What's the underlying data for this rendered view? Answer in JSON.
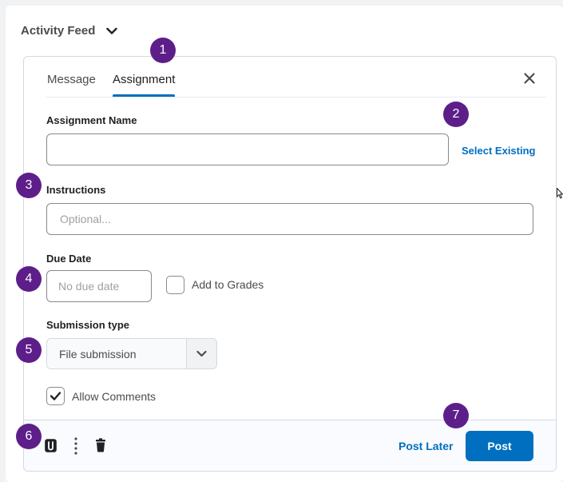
{
  "feed": {
    "title": "Activity Feed",
    "toggle_icon": "chevron-down-icon"
  },
  "tabs": [
    {
      "label": "Message",
      "active": false
    },
    {
      "label": "Assignment",
      "active": true
    }
  ],
  "close_icon": "close-icon",
  "form": {
    "assignment_name": {
      "label": "Assignment Name",
      "value": "",
      "placeholder": ""
    },
    "select_existing": "Select Existing",
    "instructions": {
      "label": "Instructions",
      "placeholder": "Optional..."
    },
    "due_date": {
      "label": "Due Date",
      "placeholder": "No due date"
    },
    "add_to_grades": {
      "label": "Add to Grades",
      "checked": false
    },
    "submission_type": {
      "label": "Submission type",
      "selected": "File submission"
    },
    "allow_comments": {
      "label": "Allow Comments",
      "checked": true
    }
  },
  "footer": {
    "attach_icon": "attachment-icon",
    "more_icon": "more-vertical-icon",
    "delete_icon": "trash-icon",
    "post_later": "Post Later",
    "post": "Post"
  },
  "callouts": [
    "1",
    "2",
    "3",
    "4",
    "5",
    "6",
    "7"
  ],
  "colors": {
    "accent": "#006fbf",
    "callout": "#5d1e8a",
    "border": "#878a8c"
  }
}
